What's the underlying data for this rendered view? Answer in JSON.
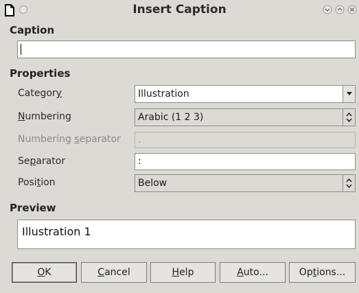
{
  "window": {
    "title": "Insert Caption"
  },
  "caption": {
    "section_label": "Caption",
    "value": ""
  },
  "properties": {
    "section_label": "Properties",
    "category": {
      "label_pre": "Categor",
      "label_u": "y",
      "label_post": "",
      "value": "Illustration"
    },
    "numbering": {
      "label_pre": "",
      "label_u": "N",
      "label_post": "umbering",
      "value": "Arabic (1 2 3)"
    },
    "numbering_separator": {
      "label_pre": "Numbering ",
      "label_u": "s",
      "label_post": "eparator",
      "value": "."
    },
    "separator": {
      "label_pre": "Se",
      "label_u": "p",
      "label_post": "arator",
      "value": ":"
    },
    "position": {
      "label_pre": "Posi",
      "label_u": "t",
      "label_post": "ion",
      "value": "Below"
    }
  },
  "preview": {
    "section_label": "Preview",
    "text": "Illustration 1"
  },
  "buttons": {
    "ok": {
      "u": "O",
      "rest": "K"
    },
    "cancel": {
      "u": "C",
      "rest": "ancel"
    },
    "help": {
      "u": "H",
      "rest": "elp"
    },
    "auto": {
      "u": "A",
      "rest": "uto..."
    },
    "options": {
      "pre": "Op",
      "u": "t",
      "rest": "ions..."
    }
  }
}
